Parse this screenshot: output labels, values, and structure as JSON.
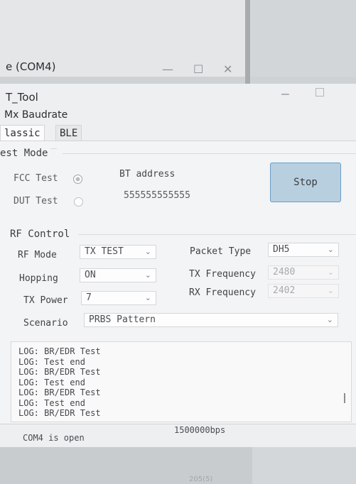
{
  "background_window": {
    "title": "e (COM4)",
    "minimize_glyph": "—",
    "maximize_glyph": "☐",
    "close_glyph": "✕"
  },
  "window": {
    "title": "T_Tool",
    "minimize_glyph": "—"
  },
  "menu": {
    "items_text": "Mx  Baudrate"
  },
  "tabs": [
    {
      "label": "lassic",
      "active": true
    },
    {
      "label": "BLE",
      "active": false
    }
  ],
  "test_mode": {
    "title": "est Mode",
    "fcc_label": "FCC Test",
    "fcc_selected": true,
    "dut_label": "DUT Test",
    "dut_selected": false,
    "bt_address_label": "BT address",
    "bt_address_value": "555555555555",
    "stop_label": "Stop"
  },
  "rf_control": {
    "title": "RF Control",
    "rf_mode_label": "RF Mode",
    "rf_mode_value": "TX TEST",
    "hopping_label": "Hopping",
    "hopping_value": "ON",
    "tx_power_label": "TX Power",
    "tx_power_value": "7",
    "scenario_label": "Scenario",
    "scenario_value": "PRBS Pattern",
    "packet_type_label": "Packet Type",
    "packet_type_value": "DH5",
    "tx_frequency_label": "TX Frequency",
    "tx_frequency_value": "2480",
    "rx_frequency_label": "RX Frequency",
    "rx_frequency_value": "2402"
  },
  "log": [
    "LOG: BR/EDR Test",
    "LOG: Test end",
    "LOG: BR/EDR Test",
    "LOG: Test end",
    "LOG: BR/EDR Test",
    "LOG: Test end",
    "LOG: BR/EDR Test"
  ],
  "status": {
    "port": "COM4 is open",
    "baudrate": "1500000bps"
  },
  "bottom_text": "205(5)",
  "colors": {
    "stop_button_bg": "#b8cfe0",
    "stop_button_border": "#6a9dc7"
  }
}
